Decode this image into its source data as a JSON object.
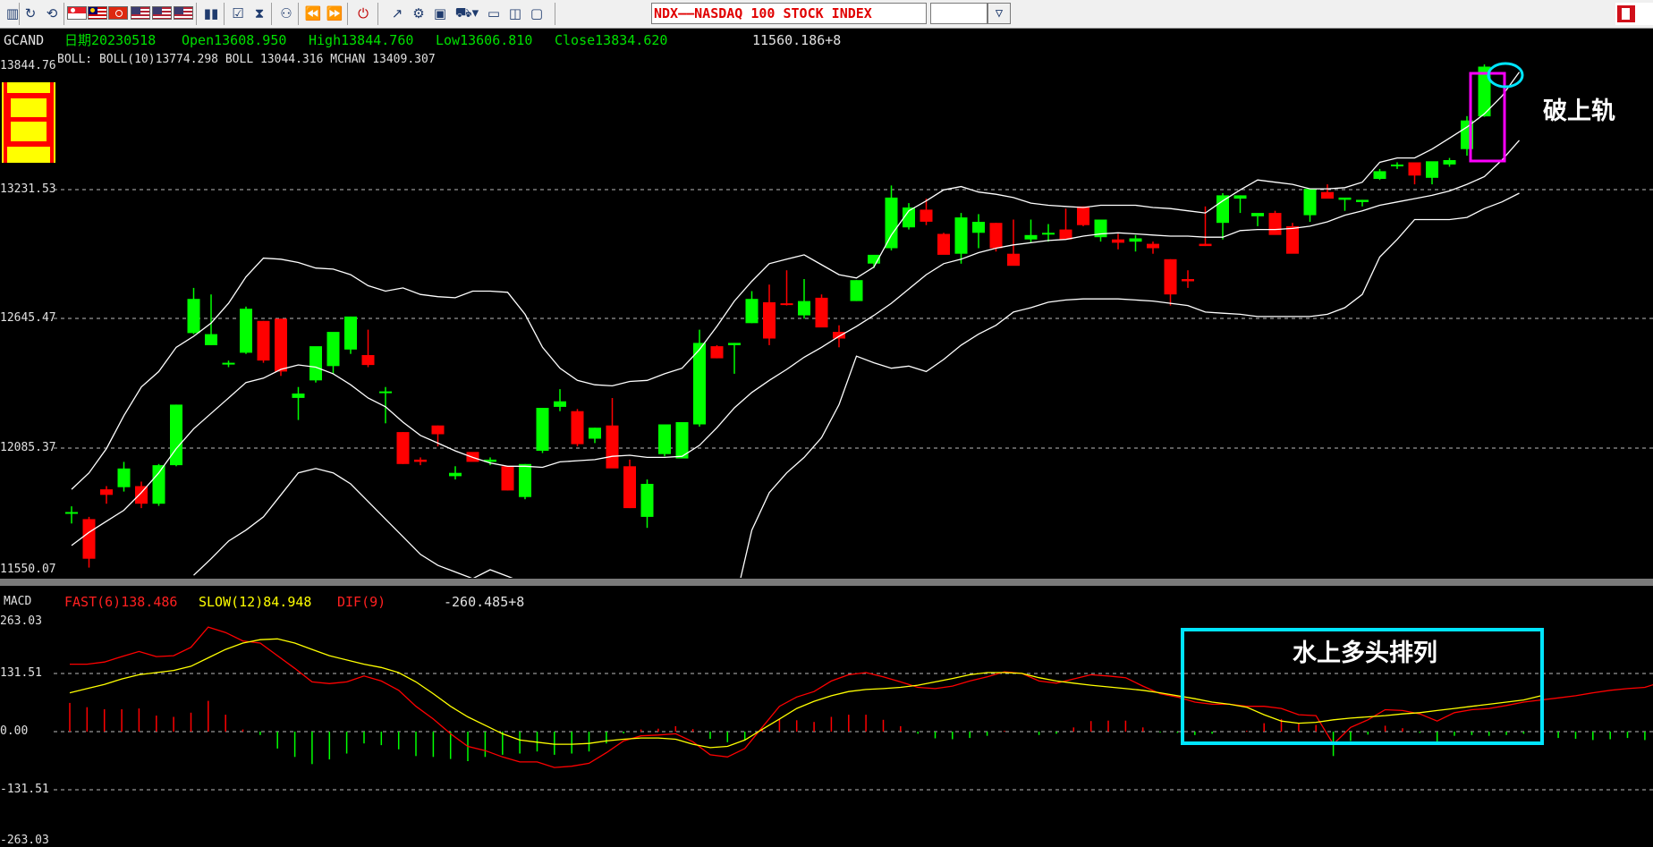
{
  "toolbar": {
    "security_title": "NDX——NASDAQ 100 STOCK INDEX",
    "period_value": "",
    "icons": [
      "split-view-icon",
      "cycle-icon",
      "hk-flag-icon",
      "sg-flag-icon",
      "my-flag-icon",
      "hk-flag-icon",
      "us-flag-icon",
      "us-flag-icon",
      "us-flag-icon",
      "bar-chart-icon",
      "notepad-icon",
      "hourglass-icon",
      "network-icon",
      "rewind-icon",
      "fast-forward-icon",
      "power-icon",
      "draw-line-icon",
      "settings-icon",
      "basket-icon",
      "folder-icon",
      "folder-open-icon",
      "monitor-icon"
    ]
  },
  "main": {
    "symbol": "GCAND",
    "date": "日期20230518",
    "open": "Open13608.950",
    "high": "High13844.760",
    "low": "Low13606.810",
    "close": "Close13834.620",
    "extra": "11560.186+8",
    "boll_line": "BOLL: BOLL(10)13774.298  BOLL 13044.316  MCHAN 13409.307",
    "axis_labels": [
      "13844.76",
      "13231.53",
      "12645.47",
      "12085.37",
      "11550.07"
    ],
    "callout": "破上轨",
    "candle_icon_color": "#ffff00"
  },
  "macd": {
    "label": "MACD",
    "fast": "FAST(6)138.486",
    "slow": "SLOW(12)84.948",
    "dif": "DIF(9)",
    "extra": "-260.485+8",
    "axis_labels": [
      "263.03",
      "131.51",
      "0.00",
      "-131.51",
      "-263.03"
    ],
    "callout": "水上多头排列"
  },
  "colors": {
    "up": "#00ff00",
    "down": "#ff0000",
    "band": "#ffffff",
    "fast_line": "#ff0000",
    "slow_line": "#ffff00",
    "highlight_box": "#ff00ff",
    "highlight_circle": "#00e5ff",
    "macd_box": "#00e5ff"
  },
  "chart_data": [
    {
      "type": "candlestick",
      "title": "",
      "ylim": [
        11550.07,
        13844.76
      ],
      "y_ticks": [
        13844.76,
        13231.53,
        12645.47,
        12085.37,
        11550.07
      ],
      "candles": [
        [
          11810,
          11838,
          11760,
          11812
        ],
        [
          11780,
          11790,
          11560,
          11600
        ],
        [
          11915,
          11930,
          11850,
          11890
        ],
        [
          11925,
          12040,
          11905,
          12010
        ],
        [
          11930,
          11950,
          11830,
          11850
        ],
        [
          11850,
          12030,
          11840,
          12025
        ],
        [
          12025,
          12300,
          12020,
          12300
        ],
        [
          12625,
          12830,
          12620,
          12780
        ],
        [
          12570,
          12800,
          12570,
          12620
        ],
        [
          12490,
          12500,
          12470,
          12490
        ],
        [
          12535,
          12745,
          12530,
          12735
        ],
        [
          12680,
          12680,
          12490,
          12500
        ],
        [
          12690,
          12690,
          12430,
          12450
        ],
        [
          12330,
          12380,
          12230,
          12350
        ],
        [
          12410,
          12560,
          12400,
          12565
        ],
        [
          12475,
          12600,
          12440,
          12630
        ],
        [
          12550,
          12700,
          12530,
          12700
        ],
        [
          12525,
          12640,
          12470,
          12480
        ],
        [
          12355,
          12380,
          12215,
          12360
        ],
        [
          12175,
          12175,
          12030,
          12030
        ],
        [
          12050,
          12060,
          12025,
          12040
        ],
        [
          12205,
          12205,
          12110,
          12165
        ],
        [
          11975,
          12020,
          11960,
          11990
        ],
        [
          12085,
          12080,
          12050,
          12040
        ],
        [
          12040,
          12060,
          12025,
          12050
        ],
        [
          12020,
          12020,
          11910,
          11910
        ],
        [
          11880,
          12030,
          11870,
          12030
        ],
        [
          12090,
          12260,
          12080,
          12285
        ],
        [
          12290,
          12370,
          12270,
          12315
        ],
        [
          12270,
          12280,
          12110,
          12120
        ],
        [
          12145,
          12195,
          12125,
          12195
        ],
        [
          12205,
          12330,
          12030,
          12010
        ],
        [
          12020,
          12050,
          11830,
          11830
        ],
        [
          11790,
          11960,
          11740,
          11940
        ],
        [
          12075,
          12150,
          12065,
          12210
        ],
        [
          12055,
          12120,
          12080,
          12220
        ],
        [
          12210,
          12640,
          12200,
          12580
        ],
        [
          12565,
          12570,
          12510,
          12510
        ],
        [
          12570,
          12580,
          12440,
          12580
        ],
        [
          12670,
          12815,
          12670,
          12780
        ],
        [
          12765,
          12845,
          12570,
          12600
        ],
        [
          12760,
          12910,
          12750,
          12755
        ],
        [
          12705,
          12870,
          12690,
          12770
        ],
        [
          12785,
          12800,
          12680,
          12650
        ],
        [
          12630,
          12660,
          12560,
          12600
        ],
        [
          12770,
          12865,
          12770,
          12865
        ],
        [
          12940,
          12970,
          12920,
          12980
        ],
        [
          13010,
          13295,
          13000,
          13240
        ],
        [
          13105,
          13215,
          13095,
          13195
        ],
        [
          13185,
          13235,
          13115,
          13130
        ],
        [
          13075,
          13080,
          12990,
          12980
        ],
        [
          12985,
          13170,
          12940,
          13150
        ],
        [
          13080,
          13165,
          13010,
          13130
        ],
        [
          13125,
          13125,
          12995,
          13010
        ],
        [
          12985,
          13140,
          12935,
          12930
        ],
        [
          13050,
          13140,
          13035,
          13070
        ],
        [
          13080,
          13120,
          13040,
          13080
        ],
        [
          13095,
          13190,
          13070,
          13050
        ],
        [
          13200,
          13200,
          13110,
          13115
        ],
        [
          13060,
          13115,
          13040,
          13140
        ],
        [
          13050,
          13075,
          13005,
          13035
        ],
        [
          13040,
          13070,
          12995,
          13055
        ],
        [
          13030,
          13040,
          12985,
          13010
        ],
        [
          12960,
          12960,
          12750,
          12800
        ],
        [
          12870,
          12910,
          12830,
          12860
        ],
        [
          13030,
          13200,
          13020,
          13020
        ],
        [
          13125,
          13260,
          13050,
          13250
        ],
        [
          13235,
          13250,
          13170,
          13250
        ],
        [
          13155,
          13155,
          13110,
          13170
        ],
        [
          13170,
          13180,
          13080,
          13070
        ],
        [
          13110,
          13125,
          13000,
          12985
        ],
        [
          13160,
          13280,
          13130,
          13280
        ],
        [
          13265,
          13300,
          13260,
          13235
        ],
        [
          13230,
          13235,
          13180,
          13240
        ],
        [
          13220,
          13230,
          13200,
          13230
        ],
        [
          13325,
          13370,
          13320,
          13360
        ],
        [
          13385,
          13400,
          13370,
          13390
        ],
        [
          13400,
          13400,
          13300,
          13340
        ],
        [
          13330,
          13400,
          13300,
          13405
        ],
        [
          13390,
          13420,
          13380,
          13410
        ],
        [
          13460,
          13610,
          13430,
          13590
        ],
        [
          13608.95,
          13844.76,
          13606.81,
          13834.62
        ]
      ],
      "boll_upper": [
        11915,
        11990,
        12100,
        12250,
        12380,
        12450,
        12560,
        12610,
        12670,
        12760,
        12880,
        12965,
        12960,
        12945,
        12920,
        12915,
        12890,
        12840,
        12815,
        12830,
        12800,
        12790,
        12785,
        12815,
        12815,
        12810,
        12710,
        12560,
        12465,
        12410,
        12390,
        12385,
        12405,
        12410,
        12440,
        12465,
        12550,
        12655,
        12770,
        12860,
        12940,
        12960,
        12980,
        12935,
        12890,
        12875,
        12925,
        13070,
        13180,
        13225,
        13275,
        13290,
        13265,
        13255,
        13240,
        13215,
        13205,
        13200,
        13195,
        13205,
        13205,
        13205,
        13195,
        13190,
        13180,
        13170,
        13225,
        13275,
        13320,
        13310,
        13300,
        13280,
        13280,
        13285,
        13310,
        13400,
        13420,
        13420,
        13460,
        13510,
        13560,
        13620,
        13700,
        13810
      ],
      "boll_mid": [
        11660,
        11720,
        11770,
        11820,
        11900,
        11990,
        12100,
        12190,
        12260,
        12330,
        12400,
        12420,
        12460,
        12480,
        12470,
        12440,
        12390,
        12330,
        12290,
        12220,
        12160,
        12125,
        12090,
        12060,
        12035,
        12020,
        12020,
        12015,
        12040,
        12045,
        12050,
        12065,
        12070,
        12060,
        12060,
        12065,
        12115,
        12195,
        12285,
        12355,
        12410,
        12460,
        12515,
        12560,
        12610,
        12655,
        12705,
        12760,
        12825,
        12890,
        12940,
        12960,
        12990,
        13010,
        13025,
        13035,
        13045,
        13050,
        13065,
        13075,
        13080,
        13075,
        13070,
        13065,
        13065,
        13060,
        13060,
        13090,
        13095,
        13095,
        13100,
        13110,
        13130,
        13160,
        13180,
        13205,
        13220,
        13235,
        13250,
        13270,
        13300,
        13335,
        13410,
        13500
      ],
      "boll_lower": [
        null,
        null,
        null,
        null,
        null,
        null,
        null,
        11525,
        11600,
        11680,
        11730,
        11790,
        11890,
        11990,
        12010,
        11990,
        11940,
        11860,
        11780,
        11700,
        11620,
        11570,
        11540,
        11510,
        11550,
        11520,
        11490,
        11450,
        11420,
        11420,
        11405,
        11410,
        11400,
        11335,
        11310,
        11295,
        11270,
        11280,
        11390,
        11730,
        11900,
        11990,
        12060,
        12150,
        12300,
        12520,
        12490,
        12465,
        12475,
        12450,
        12505,
        12570,
        12620,
        12660,
        12720,
        12740,
        12765,
        12775,
        12780,
        12780,
        12780,
        12775,
        12770,
        12760,
        12750,
        12720,
        12715,
        12710,
        12700,
        12700,
        12700,
        12700,
        12710,
        12740,
        12800,
        12970,
        13050,
        13140,
        13140,
        13140,
        13150,
        13190,
        13220,
        13260
      ]
    },
    {
      "type": "line",
      "title": "MACD",
      "ylim": [
        -263.03,
        263.03
      ],
      "y_ticks": [
        263.03,
        131.51,
        0.0,
        -131.51,
        -263.03
      ],
      "series": [
        {
          "name": "FAST(6)",
          "values": [
            160,
            160,
            165,
            178,
            190,
            178,
            180,
            200,
            248,
            235,
            215,
            210,
            180,
            150,
            118,
            114,
            118,
            132,
            120,
            98,
            60,
            30,
            -5,
            -35,
            -45,
            -60,
            -72,
            -72,
            -85,
            -82,
            -75,
            -50,
            -22,
            -10,
            -8,
            -5,
            -24,
            -55,
            -60,
            -40,
            10,
            60,
            82,
            95,
            120,
            135,
            140,
            130,
            118,
            105,
            102,
            108,
            120,
            130,
            142,
            138,
            120,
            115,
            125,
            135,
            132,
            128,
            108,
            90,
            82,
            70,
            65,
            65,
            60,
            60,
            55,
            40,
            38,
            -30,
            10,
            28,
            52,
            50,
            42,
            25,
            45,
            52,
            55,
            62,
            70,
            75,
            80,
            85,
            92,
            98,
            102,
            105,
            118,
            138
          ]
        },
        {
          "name": "SLOW(12)",
          "values": [
            92,
            102,
            112,
            125,
            135,
            140,
            145,
            155,
            175,
            195,
            210,
            218,
            220,
            210,
            195,
            180,
            170,
            160,
            152,
            140,
            118,
            90,
            60,
            35,
            15,
            -5,
            -20,
            -25,
            -30,
            -30,
            -28,
            -22,
            -18,
            -15,
            -15,
            -18,
            -30,
            -38,
            -35,
            -20,
            5,
            30,
            55,
            72,
            85,
            95,
            100,
            102,
            105,
            110,
            118,
            126,
            135,
            140,
            140,
            138,
            128,
            120,
            115,
            110,
            106,
            102,
            98,
            92,
            85,
            78,
            70,
            65,
            58,
            40,
            25,
            20,
            22,
            28,
            32,
            35,
            38,
            42,
            45,
            50,
            55,
            60,
            65,
            70,
            75,
            85
          ]
        },
        {
          "name": "DIF(9)",
          "values": [
            68,
            58,
            53,
            53,
            55,
            38,
            35,
            45,
            73,
            40,
            5,
            -8,
            -40,
            -60,
            -77,
            -66,
            -52,
            -28,
            -32,
            -42,
            -58,
            -60,
            -65,
            -70,
            -60,
            -55,
            -52,
            -47,
            -55,
            -52,
            -47,
            -28,
            -4,
            5,
            7,
            13,
            6,
            -17,
            -25,
            -20,
            5,
            30,
            27,
            23,
            35,
            40,
            40,
            28,
            13,
            -5,
            -16,
            -18,
            -15,
            -10,
            2,
            0,
            -8,
            -5,
            10,
            25,
            26,
            26,
            10,
            -2,
            -3,
            -8,
            -5,
            0,
            2,
            20,
            30,
            20,
            16,
            -58,
            -22,
            -7,
            14,
            8,
            -3,
            -25,
            -10,
            -8,
            -10,
            -8,
            -5,
            -10,
            -15,
            -17,
            -20,
            -18,
            -15,
            -20,
            20,
            53
          ]
        }
      ]
    }
  ]
}
